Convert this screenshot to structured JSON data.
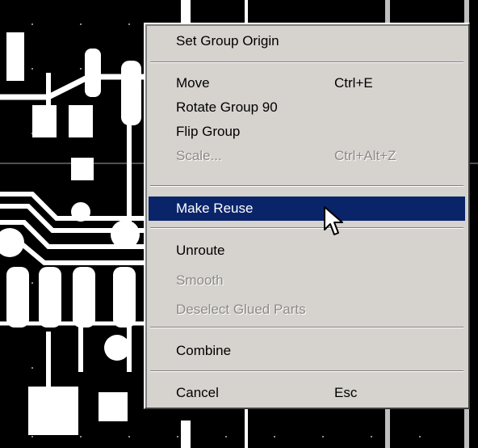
{
  "colors": {
    "pcb_background": "#000000",
    "copper": "#ffffff",
    "grid": "#bfbfbf",
    "menu_background": "#d6d3ce",
    "menu_highlight": "#0a246a",
    "menu_disabled_text": "#8c8a86"
  },
  "context_menu": {
    "items": [
      {
        "label": "Set Group Origin",
        "shortcut": "",
        "enabled": true
      },
      {
        "label": "Move",
        "shortcut": "Ctrl+E",
        "enabled": true
      },
      {
        "label": "Rotate Group 90",
        "shortcut": "",
        "enabled": true
      },
      {
        "label": "Flip Group",
        "shortcut": "",
        "enabled": true
      },
      {
        "label": "Scale...",
        "shortcut": "Ctrl+Alt+Z",
        "enabled": false
      },
      {
        "label": "Make Reuse",
        "shortcut": "",
        "enabled": true,
        "highlighted": true
      },
      {
        "label": "Unroute",
        "shortcut": "",
        "enabled": true
      },
      {
        "label": "Smooth",
        "shortcut": "",
        "enabled": false
      },
      {
        "label": "Deselect Glued Parts",
        "shortcut": "",
        "enabled": false
      },
      {
        "label": "Combine",
        "shortcut": "",
        "enabled": true
      },
      {
        "label": "Cancel",
        "shortcut": "Esc",
        "enabled": true
      }
    ]
  },
  "icons": {
    "cursor": "mouse-pointer-icon"
  }
}
